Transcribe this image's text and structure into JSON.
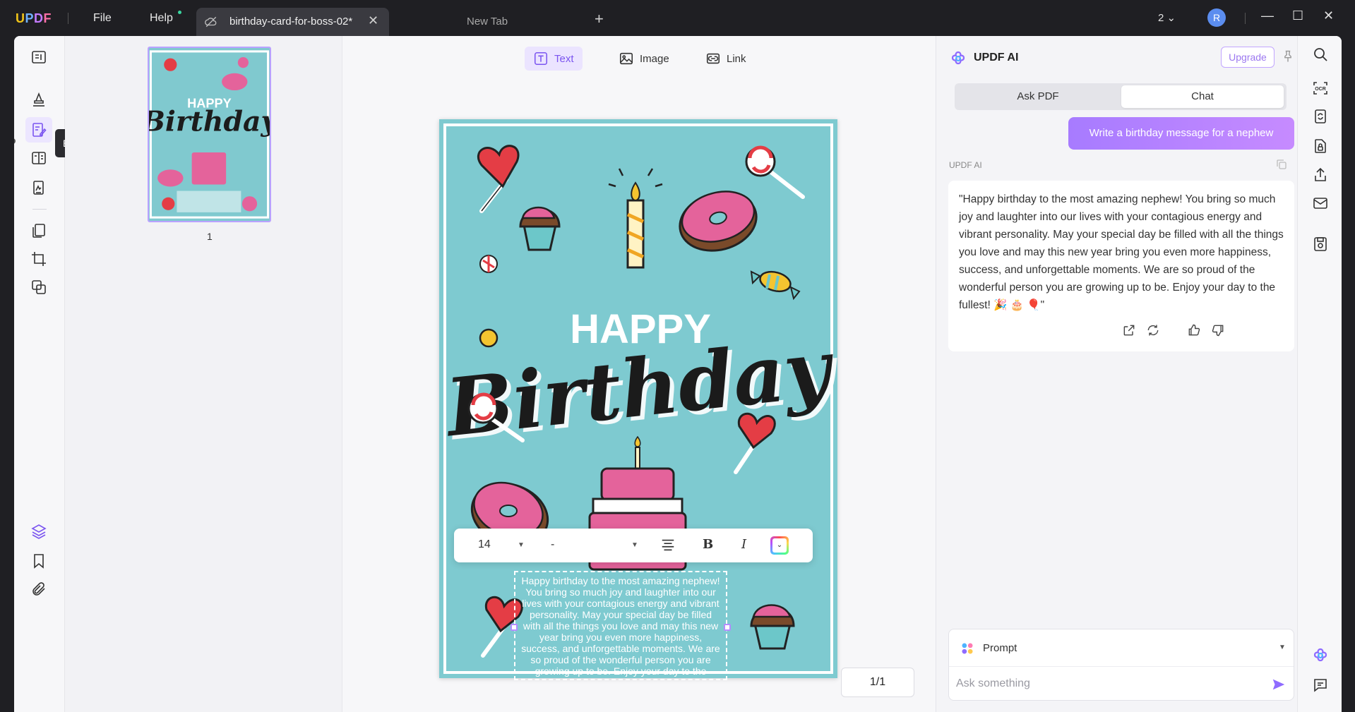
{
  "titlebar": {
    "logo": "UPDF",
    "menu": {
      "file": "File",
      "help": "Help"
    },
    "active_tab": {
      "title": "birthday-card-for-boss-02*",
      "close": "✕"
    },
    "new_tab": {
      "title": "New Tab"
    },
    "add_tab": "+",
    "window_count": "2",
    "avatar_initial": "R"
  },
  "left_toolbar": {
    "tooltip": "Edit PDF"
  },
  "thumbnails": {
    "page_number": "1"
  },
  "edit_tools": {
    "text": "Text",
    "image": "Image",
    "link": "Link"
  },
  "document": {
    "heading_happy": "HAPPY",
    "heading_birthday": "Birthday",
    "body_text": "Happy birthday to the most amazing nephew! You bring so much joy and laughter into our lives with your contagious energy and vibrant personality. May your special day be filled with all the things you love and may this new year bring you even more happiness, success, and unforgettable moments. We are so proud of the wonderful person you are growing up to be. Enjoy your day to the fullest!",
    "colors": {
      "page_bg": "#7ecad0",
      "accent": "#e4639b"
    }
  },
  "text_toolbar": {
    "font_size": "14",
    "font_family": "-",
    "bold": "B",
    "italic": "I"
  },
  "page_indicator": "1/1",
  "ai_panel": {
    "title": "UPDF AI",
    "upgrade": "Upgrade",
    "tabs": {
      "ask_pdf": "Ask PDF",
      "chat": "Chat"
    },
    "user_message": "Write a birthday message for a nephew",
    "ai_label": "UPDF AI",
    "ai_response": "\"Happy birthday to the most amazing nephew! You bring so much joy and laughter into our lives with your contagious energy and vibrant personality. May your special day be filled with all the things you love and may this new year bring you even more happiness, success, and unforgettable moments. We are so proud of the wonderful person you are growing up to be. Enjoy your day to the fullest! 🎉 🎂 🎈\"",
    "prompt_label": "Prompt",
    "ask_placeholder": "Ask something"
  }
}
